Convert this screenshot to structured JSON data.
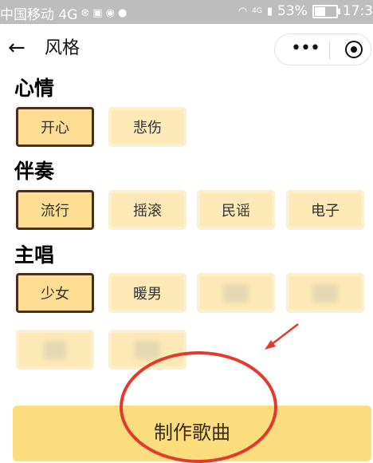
{
  "status_bar": {
    "carrier": "中国移动 4G",
    "signal_label": "4G",
    "battery_percent": "53%",
    "time": "17:3",
    "battery_fill_fraction": 0.53
  },
  "nav": {
    "back_icon": "←",
    "title": "风格",
    "more_icon": "•••"
  },
  "sections": {
    "mood": {
      "title": "心情",
      "options": [
        {
          "label": "开心",
          "selected": true
        },
        {
          "label": "悲伤",
          "selected": false
        }
      ]
    },
    "accompaniment": {
      "title": "伴奏",
      "options": [
        {
          "label": "流行",
          "selected": true
        },
        {
          "label": "摇滚",
          "selected": false
        },
        {
          "label": "民谣",
          "selected": false
        },
        {
          "label": "电子",
          "selected": false
        }
      ]
    },
    "vocal": {
      "title": "主唱",
      "options": [
        {
          "label": "少女",
          "selected": true
        },
        {
          "label": "暖男",
          "selected": false
        }
      ]
    }
  },
  "make_button": {
    "label": "制作歌曲"
  },
  "colors": {
    "chip_bg": "#fde9b6",
    "chip_selected_bg": "#fcdd92",
    "chip_selected_border": "#4a2f1a",
    "button_bg": "#fcdd7e",
    "annotation_red": "#e23a2c"
  }
}
